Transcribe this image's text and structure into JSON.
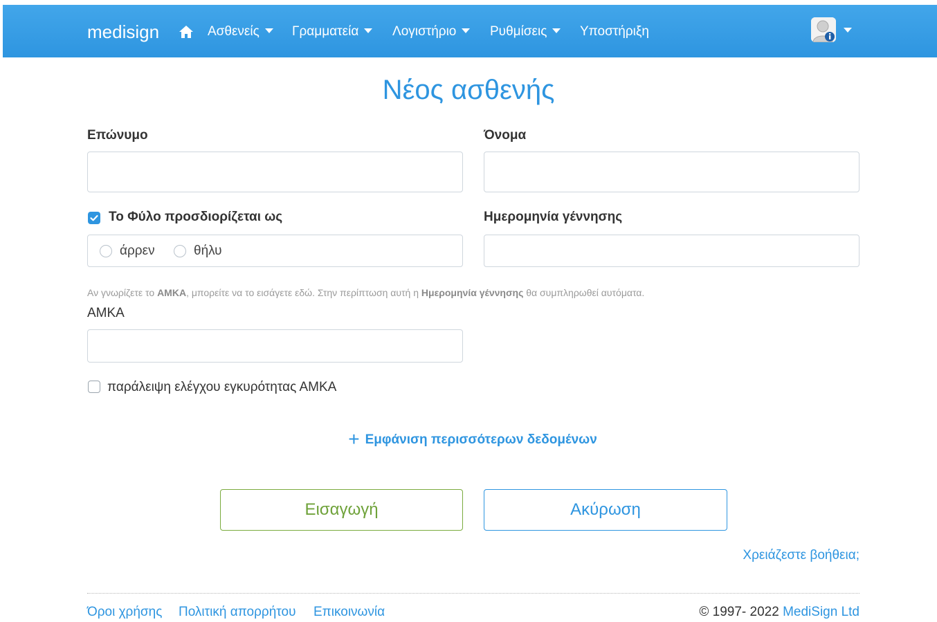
{
  "navbar": {
    "brand": "medisign",
    "home_icon": "home-icon",
    "items": [
      {
        "label": "Ασθενείς",
        "has_caret": true
      },
      {
        "label": "Γραμματεία",
        "has_caret": true
      },
      {
        "label": "Λογιστήριο",
        "has_caret": true
      },
      {
        "label": "Ρυθμίσεις",
        "has_caret": true
      },
      {
        "label": "Υποστήριξη",
        "has_caret": false
      }
    ],
    "avatar_icon": "user-info-icon"
  },
  "page": {
    "title": "Νέος ασθενής"
  },
  "form": {
    "surname_label": "Επώνυμο",
    "surname_value": "",
    "name_label": "Όνομα",
    "name_value": "",
    "gender_label": "Το Φύλο προσδιορίζεται ως",
    "gender_checked": true,
    "gender_options": [
      "άρρεν",
      "θήλυ"
    ],
    "birthdate_label": "Ημερομηνία γέννησης",
    "birthdate_value": "",
    "amka_help_1": "Αν γνωρίζετε το ",
    "amka_help_2": "ΑΜΚΑ",
    "amka_help_3": ", μπορείτε να το εισάγετε εδώ. Στην περίπτωση αυτή η ",
    "amka_help_4": "Ημερομηνία γέννησης",
    "amka_help_5": " θα συμπληρωθεί αυτόματα.",
    "amka_label": "ΑΜΚΑ",
    "amka_value": "",
    "skip_amka_label": "παράλειψη ελέγχου εγκυρότητας ΑΜΚΑ",
    "skip_amka_checked": false,
    "show_more_label": "Εμφάνιση περισσότερων δεδομένων",
    "submit_label": "Εισαγωγή",
    "cancel_label": "Ακύρωση",
    "help_link": "Χρειάζεστε βοήθεια;"
  },
  "footer": {
    "links": [
      "Όροι χρήσης",
      "Πολιτική απορρήτου",
      "Επικοινωνία"
    ],
    "copyright_prefix": "© 1997- 2022 ",
    "copyright_company": "MediSign Ltd"
  },
  "colors": {
    "accent": "#2e95e0",
    "success": "#6fa23a",
    "navbar": "#3aa0e8"
  }
}
